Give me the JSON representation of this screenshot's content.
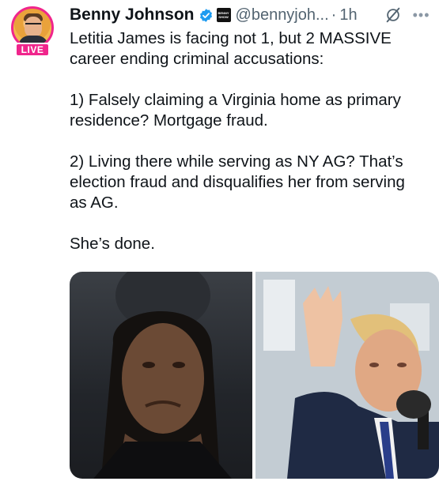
{
  "author": {
    "display_name": "Benny Johnson",
    "handle": "@bennyjoh...",
    "separator": "·",
    "time": "1h",
    "live_badge": "LIVE",
    "affiliate_badge_text": [
      "BENNY",
      "SHOW"
    ]
  },
  "tweet": {
    "text": "Letitia James is facing not 1, but 2 MASSIVE\ncareer ending criminal accusations:\n\n1) Falsely claiming a Virginia home as primary\nresidence? Mortgage fraud.\n\n2) Living there while serving as NY AG? That’s\nelection fraud and disqualifies her from serving\nas AG.\n\nShe’s done."
  },
  "icons": {
    "verified": "verified-badge-icon",
    "grok": "grok-icon",
    "more": "more-options-icon"
  },
  "colors": {
    "accent_pink": "#f0258c",
    "verified_blue": "#1d9bf0",
    "secondary_text": "#536471"
  },
  "media": {
    "count": 2,
    "images": [
      "photo-woman-portrait",
      "photo-man-raising-hand"
    ]
  }
}
